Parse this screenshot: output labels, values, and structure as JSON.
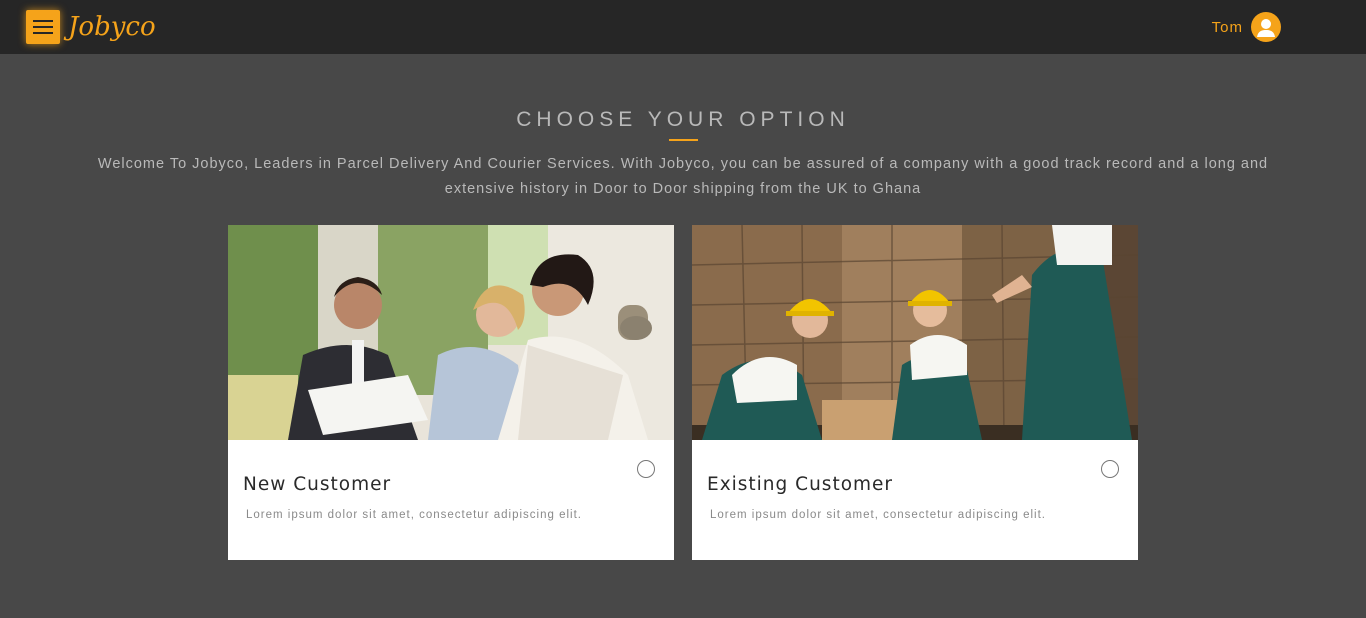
{
  "header": {
    "logo_text": "Jobyco",
    "menu_icon": "hamburger-icon",
    "user_name": "Tom",
    "avatar_icon": "user-icon",
    "accent_color": "#f5a31a"
  },
  "main": {
    "title": "CHOOSE YOUR OPTION",
    "intro_line1": "Welcome To Jobyco, Leaders in Parcel Delivery And Courier Services. With Jobyco, you can be assured of a company with a good track record and a long and",
    "intro_line2": "extensive history in Door to Door shipping from the UK to Ghana",
    "options": [
      {
        "title": "New Customer",
        "description": "Lorem ipsum dolor sit amet, consectetur adipiscing elit.",
        "selected": false
      },
      {
        "title": "Existing Customer",
        "description": "Lorem ipsum dolor sit amet, consectetur adipiscing elit.",
        "selected": false
      }
    ]
  }
}
